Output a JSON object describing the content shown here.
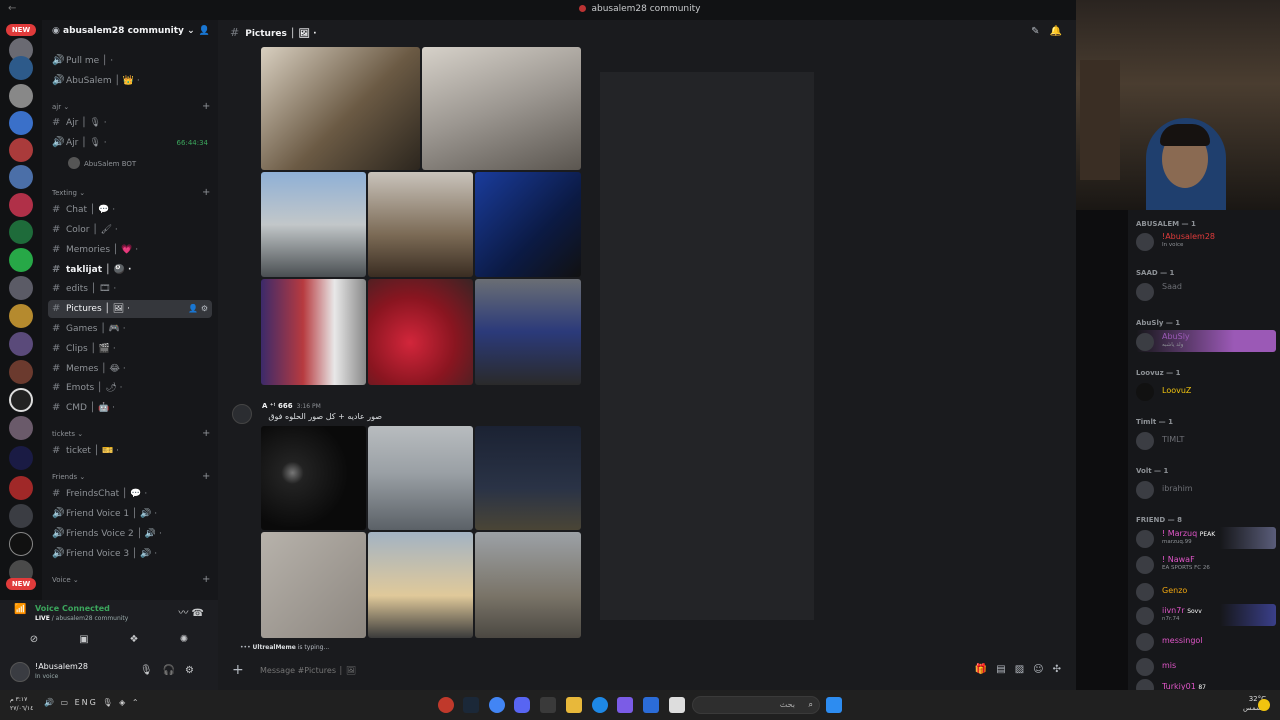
{
  "window": {
    "title": "abusalem28 community"
  },
  "server": {
    "name": "abusalem28 community"
  },
  "rail": {
    "new_label": "NEW"
  },
  "channels_top": [
    {
      "label": "Pull me │ ·"
    },
    {
      "label": "AbuSalem │ 👑 ·"
    }
  ],
  "categories": {
    "ajr": "ajr",
    "texting": "Texting",
    "tickets": "tickets",
    "friends": "Friends",
    "voice": "Voice"
  },
  "voice_ajr": [
    {
      "label": "Ajr │ 🎙 ·"
    },
    {
      "label": "Ajr │ 🎙 ·",
      "timer": "66:44:34"
    }
  ],
  "voice_user": "AbuSalem BOT",
  "texting": [
    {
      "label": "Chat │ 💬 ·"
    },
    {
      "label": "Color │ 🖌 ·"
    },
    {
      "label": "Memories │ 💗 ·"
    },
    {
      "label": "taklijat │ 🎱 ·"
    },
    {
      "label": "edits │ 🎞 ·"
    },
    {
      "label": "Pictures │ 🖼 ·"
    },
    {
      "label": "Games │ 🎮 ·"
    },
    {
      "label": "Clips │ 🎬 ·"
    },
    {
      "label": "Memes │ 😂 ·"
    },
    {
      "label": "Emots │ 🌶 ·"
    },
    {
      "label": "CMD │ 🤖 ·"
    }
  ],
  "tickets": [
    {
      "label": "ticket │ 🎫 ·"
    }
  ],
  "friends": [
    {
      "label": "FreindsChat │ 💬 ·"
    },
    {
      "label": "Friend Voice 1 │ 🔊 ·"
    },
    {
      "label": "Friends Voice 2 │ 🔊 ·"
    },
    {
      "label": "Friend Voice 3 │ 🔊 ·"
    }
  ],
  "voice_panel": {
    "status": "Voice Connected",
    "live": "LIVE",
    "sub": "/ abusalem28 community"
  },
  "user_panel": {
    "name": "!Abusalem28",
    "status": "In voice"
  },
  "chat": {
    "channel": "Pictures │ 🖼 ·",
    "author": "A ⁺ꜝ 666",
    "time": "3:16 PM",
    "text": "صور عاديه + كل صور الحلوه فوق",
    "typing_user": "UltrealMeme",
    "typing_suffix": " is typing...",
    "placeholder": "Message #Pictures │ 🖼"
  },
  "members": {
    "groups": [
      {
        "label": "ABUSALEM — 1"
      },
      {
        "label": "SAAD — 1"
      },
      {
        "label": "AbuSly — 1"
      },
      {
        "label": "Loovuz — 1"
      },
      {
        "label": "Timlt — 1"
      },
      {
        "label": "Volt — 1"
      },
      {
        "label": "FRIEND — 8"
      }
    ],
    "list": [
      {
        "name": "!Abusalem28",
        "activity": "In voice",
        "color": "#e03b3b"
      },
      {
        "name": "Saad",
        "activity": "",
        "color": "#6d6f75"
      },
      {
        "name": "AbuSly",
        "activity": "ولد ياشبه",
        "color": "#9b59b6"
      },
      {
        "name": "LoovuZ",
        "activity": "",
        "color": "#f1c40f"
      },
      {
        "name": "TIMLT",
        "activity": "",
        "color": "#6d6f75"
      },
      {
        "name": "ibrahim",
        "activity": "",
        "color": "#6d6f75"
      },
      {
        "name": "! Marzuq",
        "activity": "marzuq.99",
        "color": "#e056c8",
        "tag": "PEAK"
      },
      {
        "name": "! NawaF",
        "activity": "EA SPORTS FC 26",
        "color": "#e056c8"
      },
      {
        "name": "Genzo",
        "activity": "",
        "color": "#f1a70f"
      },
      {
        "name": "iivn7r",
        "activity": "n7r.74",
        "color": "#e056c8",
        "tag": "Sovv"
      },
      {
        "name": "messingol",
        "activity": "",
        "color": "#e056c8"
      },
      {
        "name": "mis",
        "activity": "",
        "color": "#e056c8"
      },
      {
        "name": "Turkiy01",
        "activity": "",
        "color": "#e056c8",
        "tag": "87"
      }
    ]
  },
  "taskbar": {
    "lang": "ENG",
    "search": "بحث",
    "weather_temp": "32°C",
    "weather_desc": "مشمس",
    "time": "٣:١٧ م",
    "date": "٢٧/٠٦/١٤"
  }
}
